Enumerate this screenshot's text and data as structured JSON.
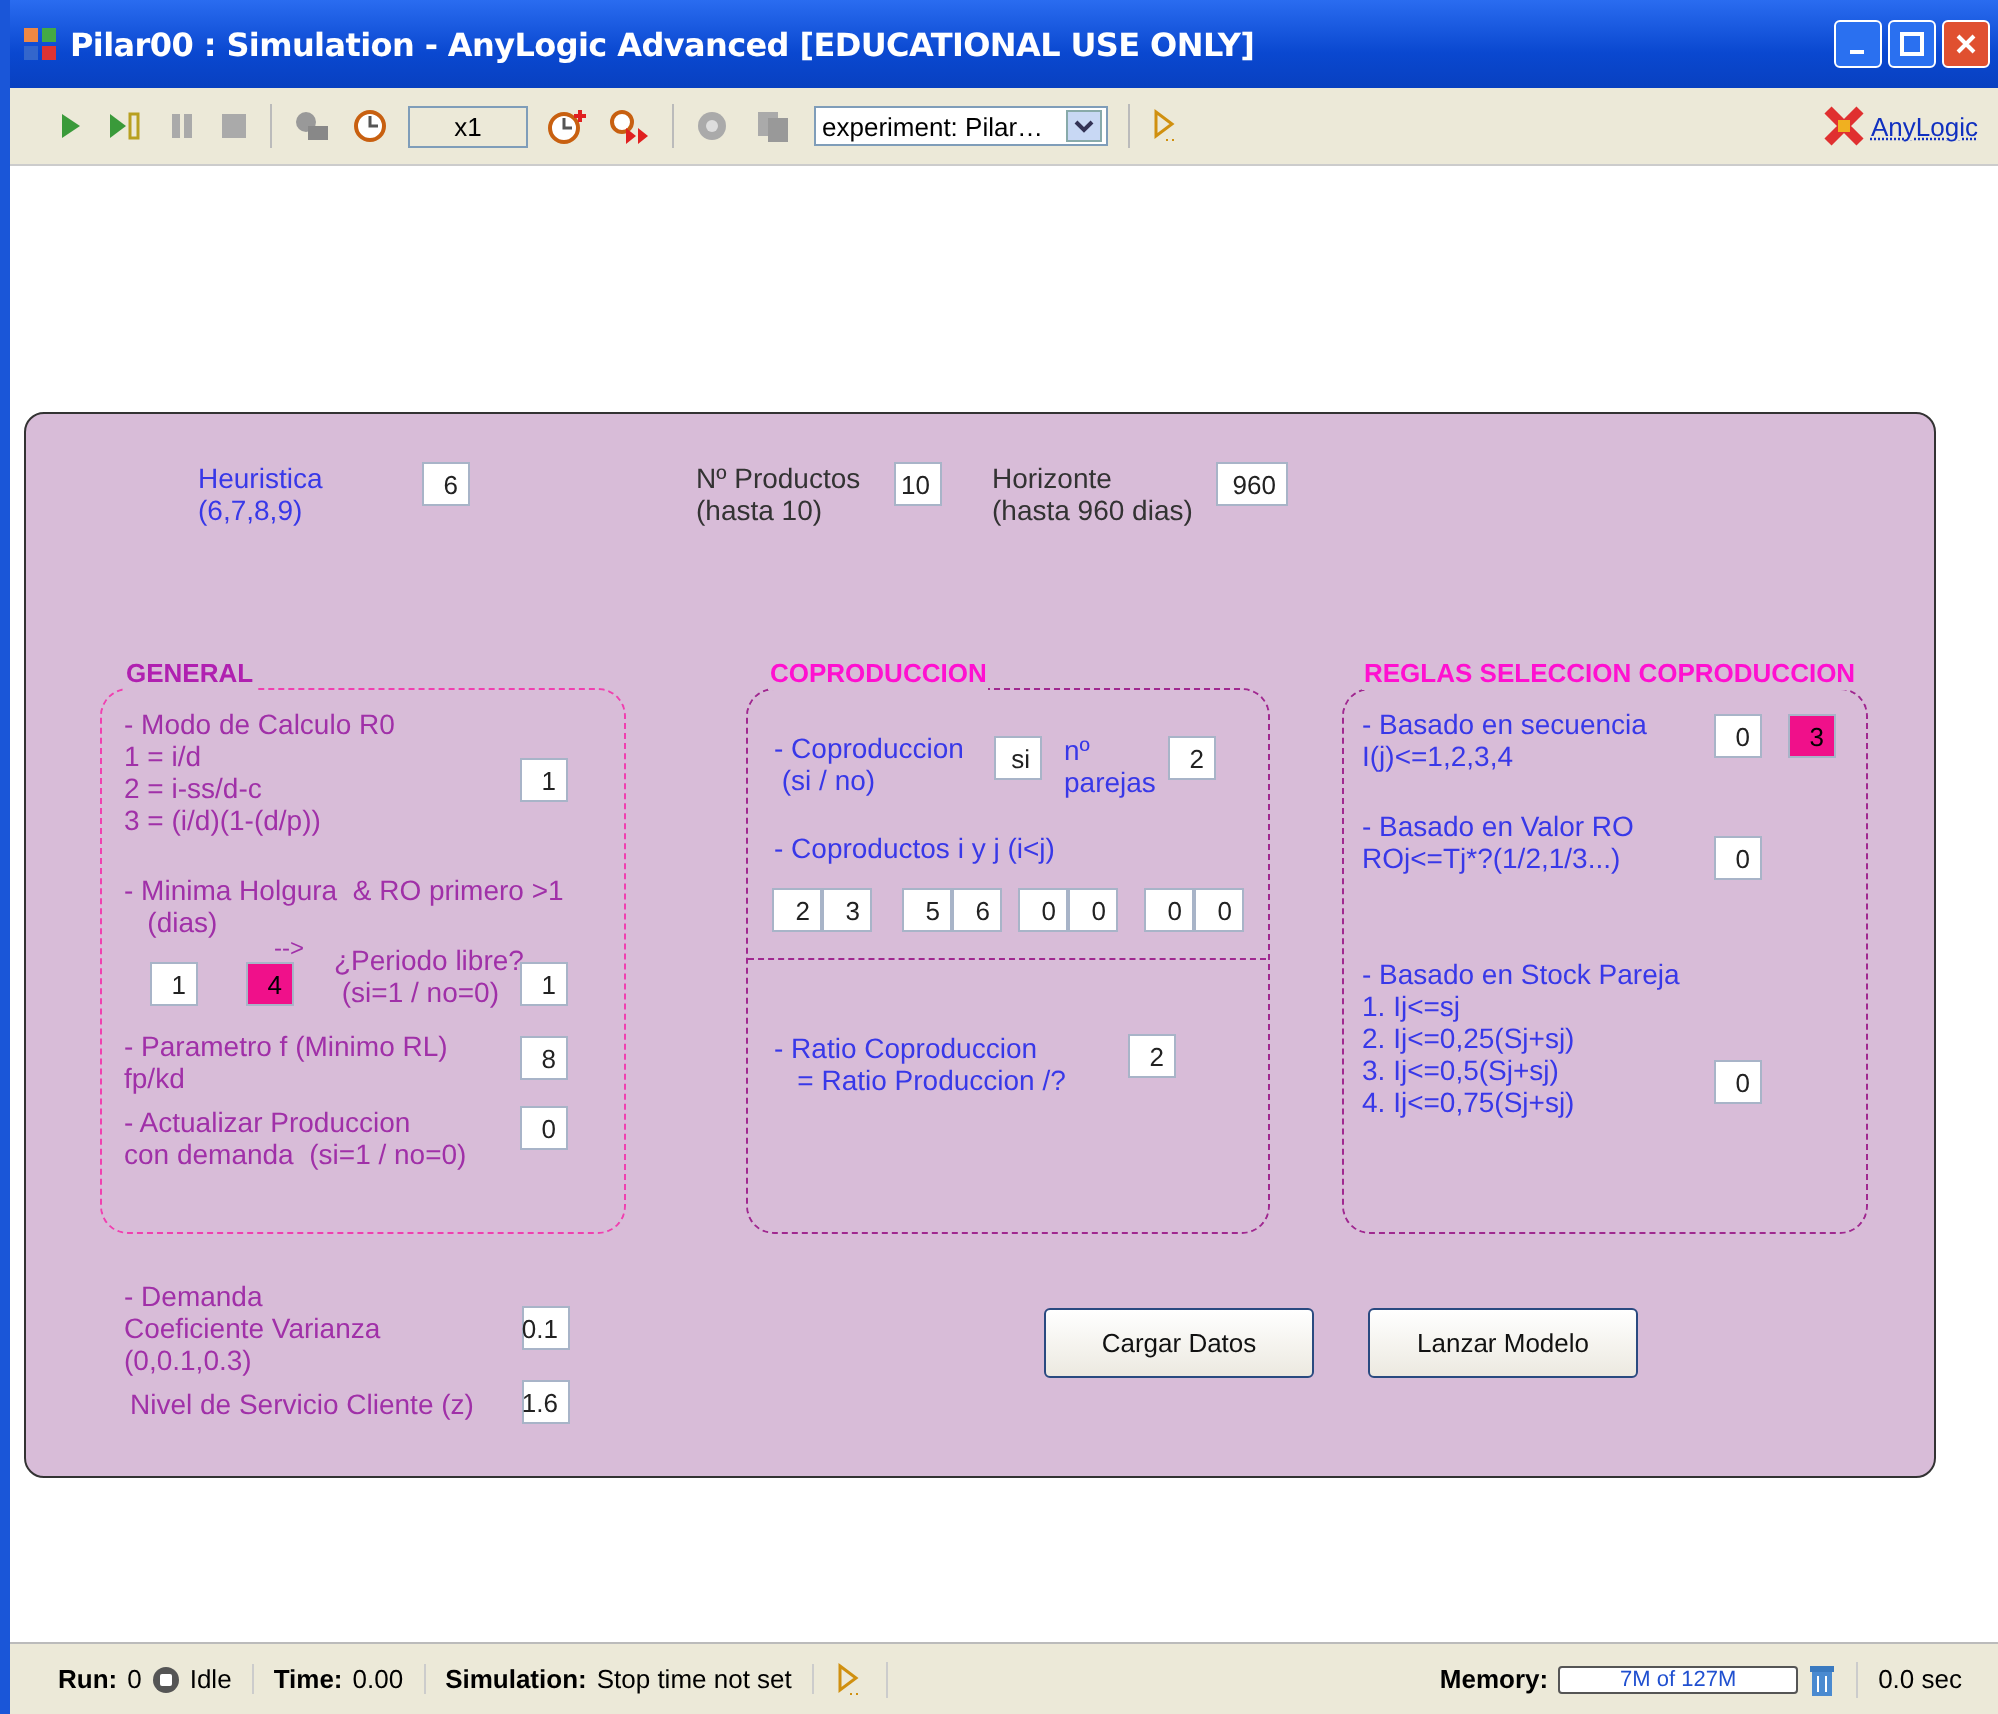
{
  "window": {
    "title": "Pilar00 : Simulation - AnyLogic Advanced [EDUCATIONAL USE ONLY]"
  },
  "toolbar": {
    "speed": "x1",
    "experiment": "experiment: Pilar…",
    "brand": "AnyLogic"
  },
  "canvas": {
    "texts": [
      {
        "text": "Heuristica\n(6,7,8,9)",
        "kind": "label",
        "color": "#3838e8"
      },
      {
        "text": "Nº Productos\n(hasta 10)",
        "kind": "label",
        "color": "#333333"
      },
      {
        "text": "Horizonte\n(hasta 960 dias)",
        "kind": "label",
        "color": "#333333"
      },
      {
        "text": "GENERAL",
        "kind": "heading",
        "color": "#b020b0"
      },
      {
        "text": "COPRODUCCION",
        "kind": "heading",
        "color": "#ff10d0"
      },
      {
        "text": "REGLAS SELECCION COPRODUCCION",
        "kind": "heading",
        "color": "#ff10d0"
      },
      {
        "text": "- Modo de Calculo R0\n1 = i/d\n2 = i-ss/d-c\n3 = (i/d)(1-(d/p))",
        "kind": "label",
        "color": "#a030a8"
      },
      {
        "text": "- Minima Holgura  & RO primero >1\n   (dias)",
        "kind": "label",
        "color": "#a030a8"
      },
      {
        "text": "-->",
        "kind": "label",
        "color": "#a030a8"
      },
      {
        "text": "¿Periodo libre?\n (si=1 / no=0)",
        "kind": "label",
        "color": "#a030a8"
      },
      {
        "text": "- Parametro f (Minimo RL)\nfp/kd",
        "kind": "label",
        "color": "#a030a8"
      },
      {
        "text": "- Actualizar Produccion\ncon demanda  (si=1 / no=0)",
        "kind": "label",
        "color": "#a030a8"
      },
      {
        "text": "- Coproduccion\n (si / no)",
        "kind": "label",
        "color": "#3838e8"
      },
      {
        "text": "nº\nparejas",
        "kind": "label",
        "color": "#3838e8"
      },
      {
        "text": "- Coproductos i y j (i<j)",
        "kind": "label",
        "color": "#3838e8"
      },
      {
        "text": "- Ratio Coproduccion\n   = Ratio Produccion /?",
        "kind": "label",
        "color": "#3838e8"
      },
      {
        "text": "- Basado en secuencia\nI(j)<=1,2,3,4",
        "kind": "label",
        "color": "#3838e8"
      },
      {
        "text": "- Basado en Valor RO\nROj<=Tj*?(1/2,1/3...)",
        "kind": "label",
        "color": "#3838e8"
      },
      {
        "text": "- Basado en Stock Pareja\n1. Ij<=sj\n2. Ij<=0,25(Sj+sj)\n3. Ij<=0,5(Sj+sj)\n4. Ij<=0,75(Sj+sj)",
        "kind": "label",
        "color": "#3838e8"
      },
      {
        "text": "- Demanda\nCoeficiente Varianza\n(0,0.1,0.3)",
        "kind": "label",
        "color": "#a030a8"
      },
      {
        "text": "Nivel de Servicio Cliente (z)",
        "kind": "label",
        "color": "#a030a8"
      }
    ],
    "fields": [
      {
        "value": "6",
        "highlighted": false
      },
      {
        "value": "10",
        "highlighted": false
      },
      {
        "value": "960",
        "highlighted": false
      },
      {
        "value": "1",
        "highlighted": false
      },
      {
        "value": "1",
        "highlighted": false
      },
      {
        "value": "4",
        "highlighted": true
      },
      {
        "value": "1",
        "highlighted": false
      },
      {
        "value": "8",
        "highlighted": false
      },
      {
        "value": "0",
        "highlighted": false
      },
      {
        "value": "si",
        "highlighted": false
      },
      {
        "value": "2",
        "highlighted": false
      },
      {
        "value": "2",
        "highlighted": false
      },
      {
        "value": "3",
        "highlighted": false
      },
      {
        "value": "5",
        "highlighted": false
      },
      {
        "value": "6",
        "highlighted": false
      },
      {
        "value": "0",
        "highlighted": false
      },
      {
        "value": "0",
        "highlighted": false
      },
      {
        "value": "0",
        "highlighted": false
      },
      {
        "value": "0",
        "highlighted": false
      },
      {
        "value": "2",
        "highlighted": false
      },
      {
        "value": "0",
        "highlighted": false
      },
      {
        "value": "3",
        "highlighted": true
      },
      {
        "value": "0",
        "highlighted": false
      },
      {
        "value": "0",
        "highlighted": false
      },
      {
        "value": "0.1",
        "highlighted": false
      },
      {
        "value": "1.6",
        "highlighted": false
      }
    ],
    "buttons": [
      "Cargar Datos",
      "Lanzar Modelo"
    ]
  },
  "status_bar": {
    "run_label": "Run:",
    "run": "0",
    "state": "Idle",
    "time_label": "Time:",
    "time": "0.00",
    "sim_label": "Simulation:",
    "sim": "Stop time not set",
    "memory_label": "Memory:",
    "memory": "7M of 127M",
    "elapsed": "0.0 sec"
  }
}
